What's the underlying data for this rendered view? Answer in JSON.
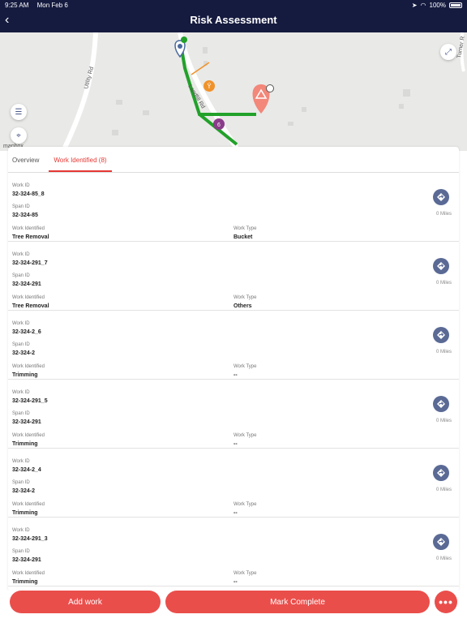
{
  "status_bar": {
    "time": "9:25 AM",
    "date": "Mon Feb 6",
    "battery": "100%"
  },
  "header": {
    "title": "Risk Assessment",
    "back_icon": "chevron-left-icon"
  },
  "map": {
    "road_labels": [
      "Utility Rd",
      "Landfill Rd",
      "Turner R"
    ],
    "cluster_count": "6",
    "attribution": "mapbox"
  },
  "tabs": [
    {
      "label": "Overview",
      "active": false
    },
    {
      "label": "Work Identified (8)",
      "active": true
    }
  ],
  "labels": {
    "work_id": "Work ID",
    "span_id": "Span ID",
    "work_identified": "Work Identified",
    "work_type": "Work Type"
  },
  "work_items": [
    {
      "work_id": "32-324-85_8",
      "span_id": "32-324-85",
      "work_identified": "Tree Removal",
      "work_type": "Bucket",
      "distance": "0 Miles"
    },
    {
      "work_id": "32-324-291_7",
      "span_id": "32-324-291",
      "work_identified": "Tree Removal",
      "work_type": "Others",
      "distance": "0 Miles"
    },
    {
      "work_id": "32-324-2_6",
      "span_id": "32-324-2",
      "work_identified": "Trimming",
      "work_type": "--",
      "distance": "0 Miles"
    },
    {
      "work_id": "32-324-291_5",
      "span_id": "32-324-291",
      "work_identified": "Trimming",
      "work_type": "--",
      "distance": "0 Miles"
    },
    {
      "work_id": "32-324-2_4",
      "span_id": "32-324-2",
      "work_identified": "Trimming",
      "work_type": "--",
      "distance": "0 Miles"
    },
    {
      "work_id": "32-324-291_3",
      "span_id": "32-324-291",
      "work_identified": "Trimming",
      "work_type": "--",
      "distance": "0 Miles"
    }
  ],
  "footer": {
    "add_work": "Add work",
    "mark_complete": "Mark Complete",
    "more": "•••"
  },
  "colors": {
    "header": "#151b3f",
    "accent": "#ea4e4b",
    "nav_button": "#5a6a95",
    "route": "#22a12a"
  }
}
